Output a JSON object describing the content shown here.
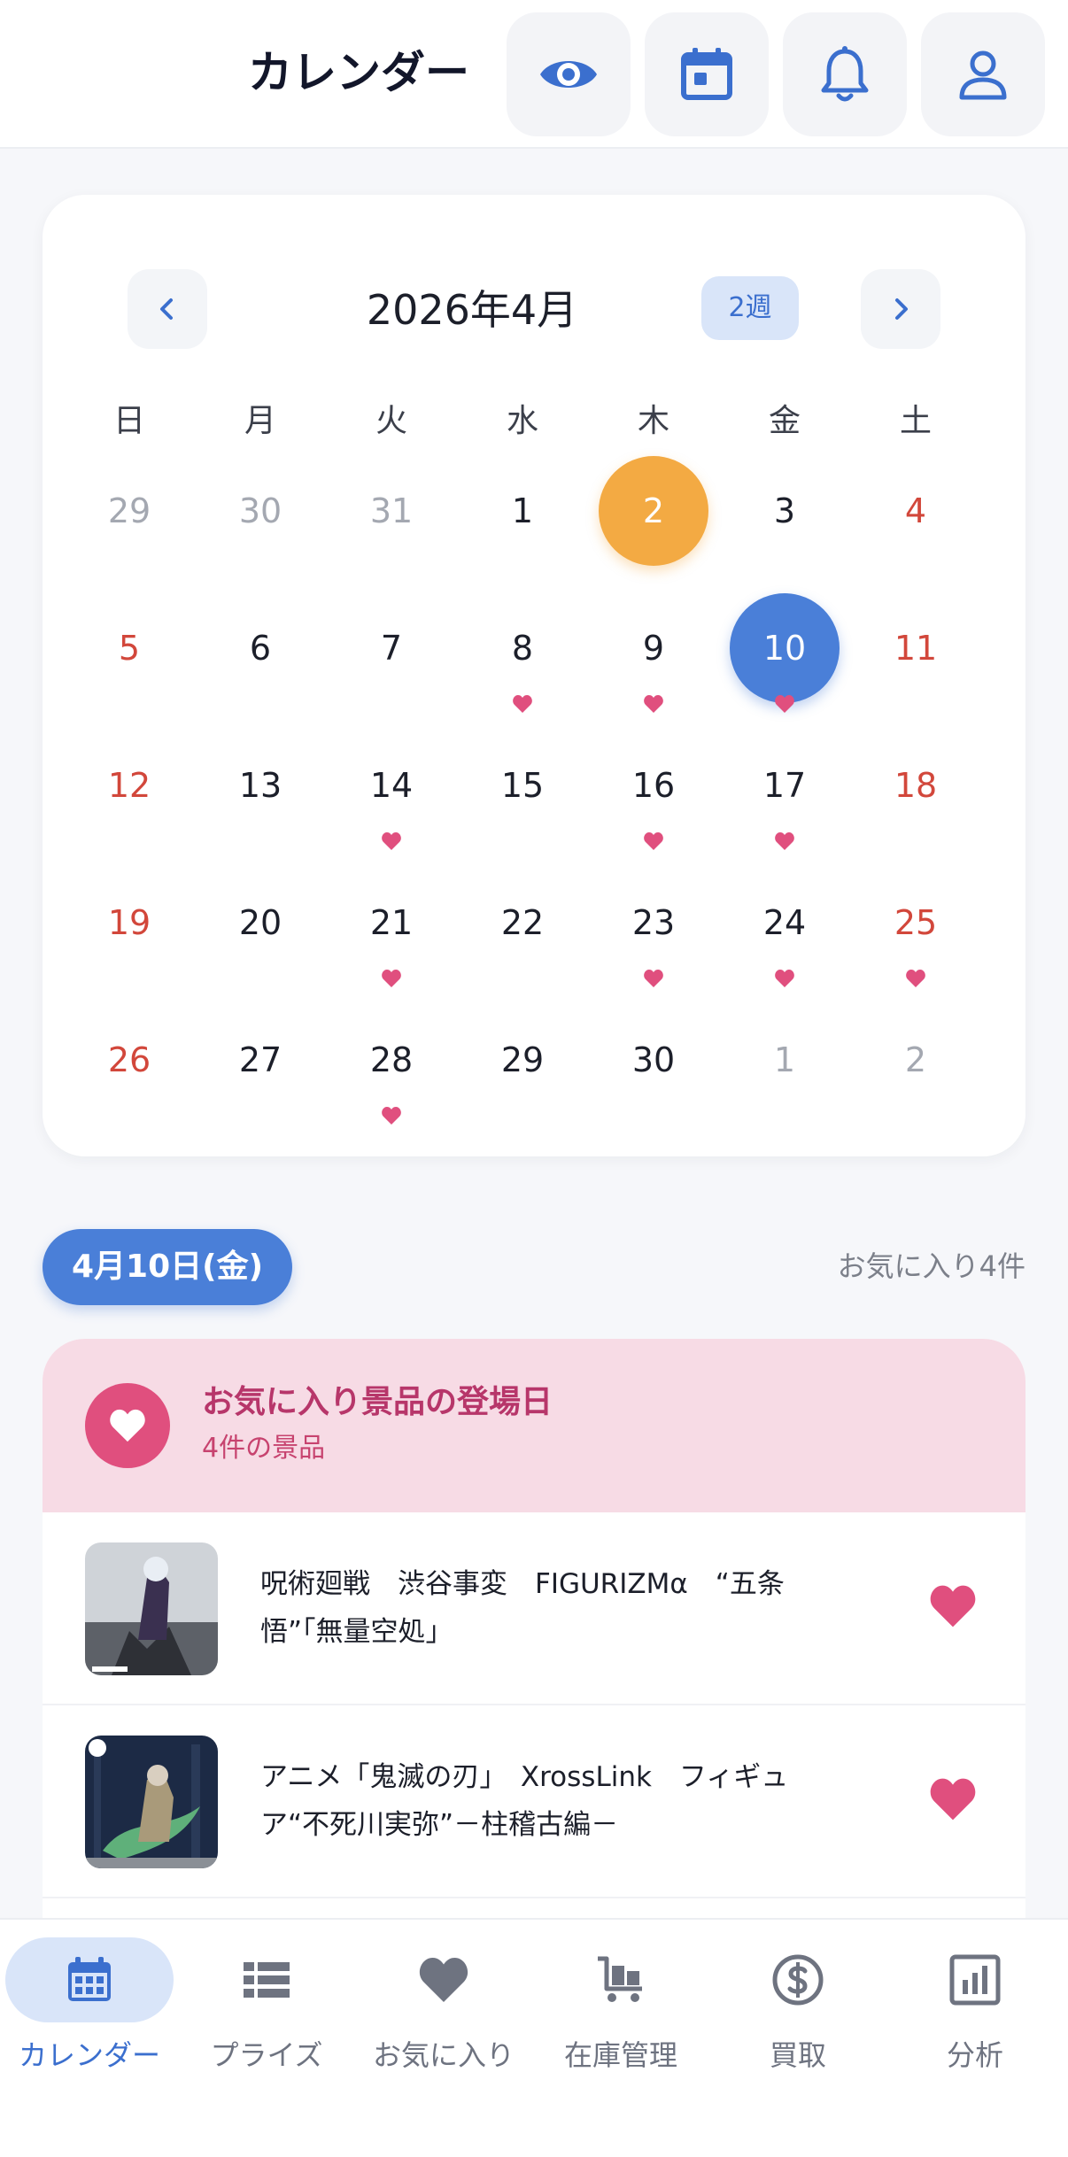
{
  "header": {
    "title": "カレンダー",
    "icons": [
      "eye-icon",
      "calendar-icon",
      "bell-icon",
      "user-icon"
    ]
  },
  "calendar": {
    "month_title": "2026年4月",
    "view_toggle": "2週",
    "weekdays": [
      "日",
      "月",
      "火",
      "水",
      "木",
      "金",
      "土"
    ],
    "weeks": [
      [
        {
          "d": "29",
          "o": true
        },
        {
          "d": "30",
          "o": true
        },
        {
          "d": "31",
          "o": true
        },
        {
          "d": "1"
        },
        {
          "d": "2",
          "today": true
        },
        {
          "d": "3"
        },
        {
          "d": "4"
        }
      ],
      [
        {
          "d": "5"
        },
        {
          "d": "6"
        },
        {
          "d": "7"
        },
        {
          "d": "8",
          "fav": true
        },
        {
          "d": "9",
          "fav": true
        },
        {
          "d": "10",
          "selected": true,
          "fav": true
        },
        {
          "d": "11"
        }
      ],
      [
        {
          "d": "12"
        },
        {
          "d": "13"
        },
        {
          "d": "14",
          "fav": true
        },
        {
          "d": "15"
        },
        {
          "d": "16",
          "fav": true
        },
        {
          "d": "17",
          "fav": true
        },
        {
          "d": "18"
        }
      ],
      [
        {
          "d": "19"
        },
        {
          "d": "20"
        },
        {
          "d": "21",
          "fav": true
        },
        {
          "d": "22"
        },
        {
          "d": "23",
          "fav": true
        },
        {
          "d": "24",
          "fav": true
        },
        {
          "d": "25",
          "fav": true
        }
      ],
      [
        {
          "d": "26"
        },
        {
          "d": "27"
        },
        {
          "d": "28",
          "fav": true
        },
        {
          "d": "29"
        },
        {
          "d": "30"
        },
        {
          "d": "1",
          "o": true
        },
        {
          "d": "2",
          "o": true
        }
      ]
    ],
    "colors": {
      "today": "#f3aa43",
      "selected": "#4a7fd8",
      "weekend": "#d2473b",
      "favorite": "#e04f7e"
    }
  },
  "selected_day": {
    "label": "4月10日(金)",
    "favorites_count": "お気に入り4件"
  },
  "favorites_panel": {
    "title": "お気に入り景品の登場日",
    "subtitle": "4件の景品",
    "items": [
      {
        "name": "呪術廻戦　渋谷事変　FIGURIZMα　“五条悟”「無量空処」"
      },
      {
        "name": "アニメ「鬼滅の刃」　XrossLink　フィギュア“不死川実弥”－柱稽古編－"
      }
    ]
  },
  "bottom_nav": {
    "tabs": [
      {
        "label": "カレンダー",
        "icon": "calendar-icon",
        "active": true
      },
      {
        "label": "プライズ",
        "icon": "list-icon"
      },
      {
        "label": "お気に入り",
        "icon": "heart-icon"
      },
      {
        "label": "在庫管理",
        "icon": "cart-icon"
      },
      {
        "label": "買取",
        "icon": "dollar-icon"
      },
      {
        "label": "分析",
        "icon": "chart-icon"
      }
    ]
  }
}
